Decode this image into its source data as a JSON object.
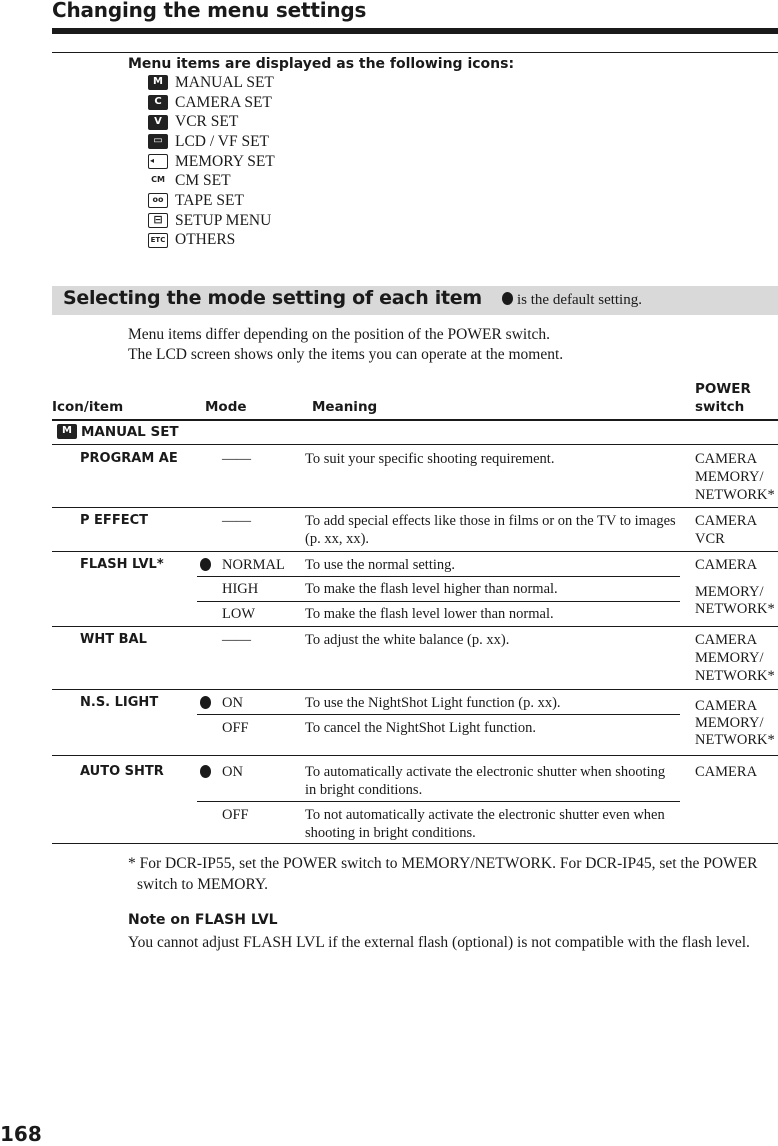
{
  "page": {
    "title": "Changing the menu settings",
    "page_number": "168"
  },
  "icons_section": {
    "intro": "Menu items are displayed as the following icons:",
    "items": [
      {
        "icon": "manual-set-icon",
        "glyph": "M",
        "label": "MANUAL SET"
      },
      {
        "icon": "camera-set-icon",
        "glyph": "C",
        "label": "CAMERA SET"
      },
      {
        "icon": "vcr-set-icon",
        "glyph": "V",
        "label": "VCR SET"
      },
      {
        "icon": "lcd-vf-set-icon",
        "glyph": "▭",
        "label": "LCD / VF SET"
      },
      {
        "icon": "memory-set-icon",
        "glyph": "◂",
        "label": "MEMORY SET"
      },
      {
        "icon": "cm-set-icon",
        "glyph": "CM",
        "label": "CM SET"
      },
      {
        "icon": "tape-set-icon",
        "glyph": "oo",
        "label": "TAPE SET"
      },
      {
        "icon": "setup-menu-icon",
        "glyph": "⊟",
        "label": "SETUP MENU"
      },
      {
        "icon": "others-icon",
        "glyph": "ETC",
        "label": "OTHERS"
      }
    ]
  },
  "mode_section": {
    "title": "Selecting the mode setting of each item",
    "default_note": "is the default setting.",
    "para_line1": "Menu items differ depending on the position of the POWER switch.",
    "para_line2": "The LCD screen shows only the items you can operate at the moment."
  },
  "table": {
    "headers": {
      "icon_item": "Icon/item",
      "mode": "Mode",
      "meaning": "Meaning",
      "power_line1": "POWER",
      "power_line2": "switch"
    },
    "group": {
      "icon": "manual-set-icon",
      "glyph": "M",
      "label": "MANUAL SET"
    },
    "rows": [
      {
        "item": "PROGRAM AE",
        "modes": [
          {
            "default": false,
            "mode": "——",
            "meaning": "To suit your specific shooting requirement."
          }
        ],
        "power": [
          "CAMERA",
          "MEMORY/",
          "NETWORK*"
        ]
      },
      {
        "item": "P EFFECT",
        "modes": [
          {
            "default": false,
            "mode": "——",
            "meaning": "To add special effects like those in films or on the TV to images (p. xx, xx)."
          }
        ],
        "power": [
          "CAMERA",
          "VCR"
        ]
      },
      {
        "item": "FLASH LVL*",
        "modes": [
          {
            "default": true,
            "mode": "NORMAL",
            "meaning": "To use the normal setting."
          },
          {
            "default": false,
            "mode": "HIGH",
            "meaning": "To make the flash level higher than normal."
          },
          {
            "default": false,
            "mode": "LOW",
            "meaning": "To make the flash level lower than normal."
          }
        ],
        "power": [
          "CAMERA",
          "MEMORY/",
          "NETWORK*"
        ]
      },
      {
        "item": "WHT BAL",
        "modes": [
          {
            "default": false,
            "mode": "——",
            "meaning": "To adjust the white balance (p. xx)."
          }
        ],
        "power": [
          "CAMERA",
          "MEMORY/",
          "NETWORK*"
        ]
      },
      {
        "item": "N.S. LIGHT",
        "modes": [
          {
            "default": true,
            "mode": "ON",
            "meaning": "To use the NightShot Light function (p. xx)."
          },
          {
            "default": false,
            "mode": "OFF",
            "meaning": "To cancel the NightShot Light function."
          }
        ],
        "power": [
          "CAMERA",
          "MEMORY/",
          "NETWORK*"
        ]
      },
      {
        "item": "AUTO SHTR",
        "modes": [
          {
            "default": true,
            "mode": "ON",
            "meaning": "To automatically activate the electronic shutter when shooting in bright conditions."
          },
          {
            "default": false,
            "mode": "OFF",
            "meaning": "To not automatically activate the electronic shutter even when shooting in bright conditions."
          }
        ],
        "power": [
          "CAMERA"
        ]
      }
    ]
  },
  "footnote": "* For DCR-IP55, set the POWER switch to MEMORY/NETWORK. For DCR-IP45, set the POWER switch to MEMORY.",
  "note": {
    "title": "Note on FLASH LVL",
    "body": "You cannot adjust FLASH LVL if the external flash (optional) is not compatible with the flash level."
  }
}
